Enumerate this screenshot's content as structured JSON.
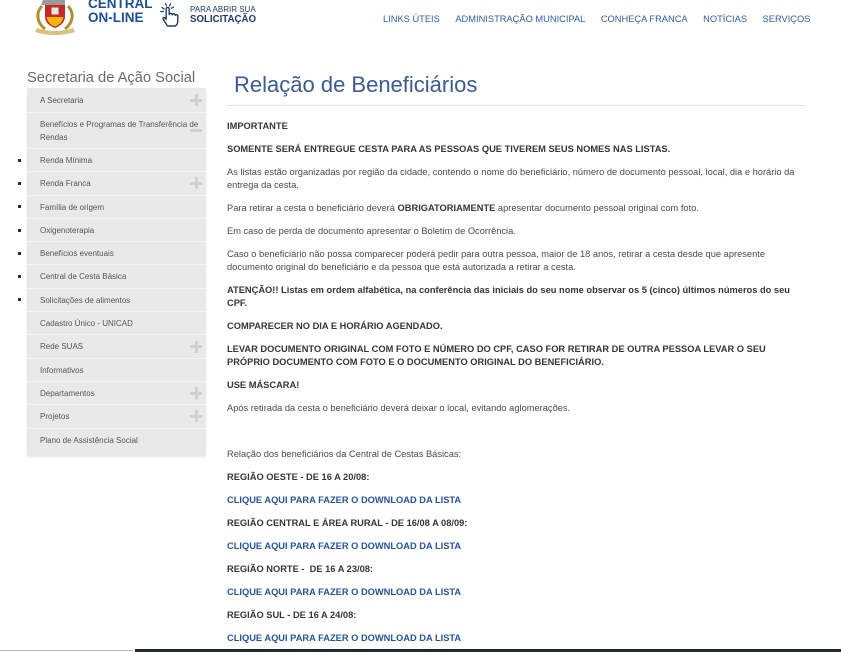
{
  "colors": {
    "brand_blue": "#1d4f91",
    "nav_blue": "#2f61a2",
    "title_blue": "#3a5c90",
    "link_blue": "#27549b",
    "sidebar_bg": "#e9e9e9",
    "text": "#4a4a4a"
  },
  "header": {
    "logo_icon": "city-crest-icon",
    "brand_line1": "CENTRAL",
    "brand_line2": "ON-LINE",
    "cta_icon": "pointing-hand-icon",
    "cta_line1": "PARA ABRIR SUA",
    "cta_line2": "SOLICITAÇÃO",
    "nav": [
      {
        "label": "LINKS ÚTEIS"
      },
      {
        "label": "ADMINISTRAÇÃO MUNICIPAL"
      },
      {
        "label": "CONHEÇA FRANCA"
      },
      {
        "label": "NOTÍCIAS"
      },
      {
        "label": "SERVIÇOS"
      }
    ]
  },
  "sidebar": {
    "title": "Secretaria de Ação Social",
    "items": [
      {
        "label": "A Secretaria",
        "icon": "plus-icon"
      },
      {
        "label": "Benefícios e Programas de Transferência de Rendas",
        "icon": "minus-icon",
        "children": [
          {
            "label": "Renda Mínima"
          },
          {
            "label": "Renda Franca",
            "icon": "plus-icon"
          },
          {
            "label": "Família de origem"
          },
          {
            "label": "Oxigenoterapia"
          },
          {
            "label": "Benefícios eventuais"
          },
          {
            "label": "Central de Cesta Básica"
          },
          {
            "label": "Solicitações de alimentos"
          }
        ]
      },
      {
        "label": "Cadastro Único - UNICAD"
      },
      {
        "label": "Rede SUAS",
        "icon": "plus-icon"
      },
      {
        "label": "Informativos"
      },
      {
        "label": "Departamentos",
        "icon": "plus-icon"
      },
      {
        "label": "Projetos",
        "icon": "plus-icon"
      },
      {
        "label": "Plano de Assistência Social"
      }
    ]
  },
  "main": {
    "title": "Relação de Beneficiários",
    "paragraphs": [
      {
        "text": "IMPORTANTE"
      },
      {
        "text": "SOMENTE SERÁ ENTREGUE CESTA PARA AS PESSOAS QUE TIVEREM SEUS NOMES NAS LISTAS."
      },
      {
        "text": "As listas estão organizadas por região da cidade, contendo o nome do beneficiário, número de documento pessoal, local, dia e horário da entrega da cesta."
      },
      {
        "before": "Para retirar a cesta o beneficiário deverá ",
        "strong": "OBRIGATORIAMENTE",
        "after": " apresentar documento pessoal original com foto."
      },
      {
        "text": "Em caso de perda de documento apresentar o Boletim de Ocorrência."
      },
      {
        "text": "Caso o beneficiário não possa comparecer poderá pedir para outra pessoa, maior de 18 anos, retirar a cesta desde que apresente documento original do beneficiário e da pessoa que está autorizada a retirar a cesta."
      },
      {
        "text": "ATENÇÃO!! Listas em ordem alfabética, na conferência das iniciais do seu nome observar os 5 (cinco) últimos números do seu CPF."
      },
      {
        "text": "COMPARECER NO DIA E HORÁRIO AGENDADO."
      },
      {
        "text": "LEVAR DOCUMENTO ORIGINAL COM FOTO E NÚMERO DO CPF, CASO FOR RETIRAR DE OUTRA PESSOA LEVAR O SEU PRÓPRIO DOCUMENTO COM FOTO E O DOCUMENTO ORIGINAL DO BENEFICIÁRIO."
      },
      {
        "text": "USE MÁSCARA!"
      },
      {
        "text": "Após retirada da cesta o beneficiário deverá deixar o local, evitando aglomerações."
      }
    ],
    "list_intro": "Relação dos beneficiários da Central de Cestas Básicas:",
    "regions": [
      {
        "label": "REGIÃO OESTE - DE 16 A 20/08:",
        "link": "CLIQUE AQUI PARA FAZER O DOWNLOAD DA LISTA"
      },
      {
        "label": "REGIÃO CENTRAL E ÁREA RURAL - DE 16/08 A 08/09:",
        "link": "CLIQUE AQUI PARA FAZER O DOWNLOAD DA LISTA"
      },
      {
        "label": "REGIÃO NORTE -  DE 16 A 23/08:",
        "link": "CLIQUE AQUI PARA FAZER O DOWNLOAD DA LISTA"
      },
      {
        "label": "REGIÃO SUL - DE 16 A 24/08:",
        "link": "CLIQUE AQUI PARA FAZER O DOWNLOAD DA LISTA"
      }
    ]
  }
}
